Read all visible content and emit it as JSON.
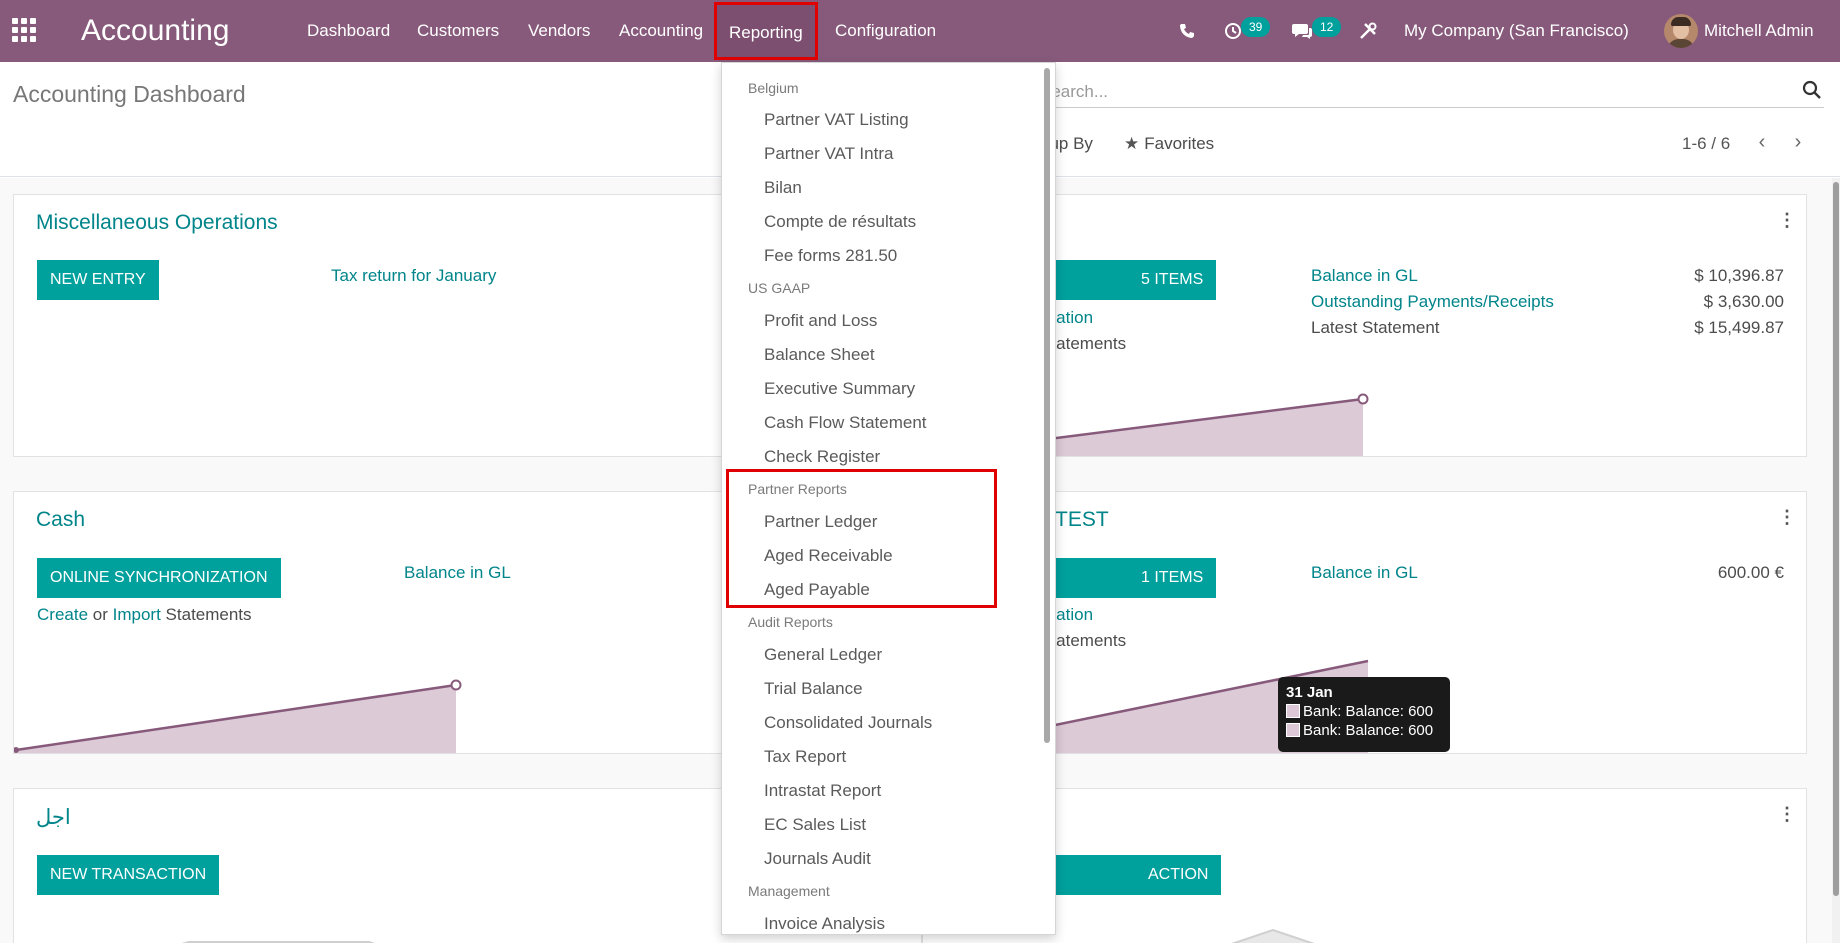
{
  "navbar": {
    "app_title": "Accounting",
    "menu": [
      "Dashboard",
      "Customers",
      "Vendors",
      "Accounting",
      "Reporting",
      "Configuration"
    ],
    "activity_count": "39",
    "message_count": "12",
    "company": "My Company (San Francisco)",
    "user": "Mitchell Admin"
  },
  "control": {
    "title": "Accounting Dashboard",
    "search_placeholder": "Search...",
    "group_by": "oup By",
    "favorites": "Favorites",
    "pager": "1-6 / 6"
  },
  "reporting_menu": {
    "sections": [
      {
        "header": "Belgium",
        "items": [
          "Partner VAT Listing",
          "Partner VAT Intra",
          "Bilan",
          "Compte de résultats",
          "Fee forms 281.50"
        ]
      },
      {
        "header": "US GAAP",
        "items": [
          "Profit and Loss",
          "Balance Sheet",
          "Executive Summary",
          "Cash Flow Statement",
          "Check Register"
        ]
      },
      {
        "header": "Partner Reports",
        "items": [
          "Partner Ledger",
          "Aged Receivable",
          "Aged Payable"
        ]
      },
      {
        "header": "Audit Reports",
        "items": [
          "General Ledger",
          "Trial Balance",
          "Consolidated Journals",
          "Tax Report",
          "Intrastat Report",
          "EC Sales List",
          "Journals Audit"
        ]
      },
      {
        "header": "Management",
        "items": [
          "Invoice Analysis"
        ]
      }
    ]
  },
  "cards": {
    "misc": {
      "title": "Miscellaneous Operations",
      "button": "New Entry",
      "link": "Tax return for January"
    },
    "bank": {
      "button_partial": "5 Items",
      "sync_partial": "onization",
      "import_partial": "rt Statements",
      "balance_label": "Balance in GL",
      "balance_value": "$ 10,396.87",
      "outstanding_label": "Outstanding Payments/Receipts",
      "outstanding_value": "$ 3,630.00",
      "latest_label": "Latest Statement",
      "latest_value": "$ 15,499.87"
    },
    "cash": {
      "title": "Cash",
      "button": "Online Synchronization",
      "balance_label": "Balance in GL",
      "create": "Create",
      "or": "or",
      "import": "Import",
      "statements": "Statements"
    },
    "test": {
      "title_partial": "TEST",
      "button_partial": "1 Items",
      "sync_partial": "onization",
      "import_partial": "rt Statements",
      "balance_label": "Balance in GL",
      "balance_value": "600.00 €"
    },
    "ajal": {
      "title": "اجل",
      "button": "New Transaction"
    },
    "last": {
      "button_partial": "ACTION"
    }
  },
  "tooltip": {
    "date": "31 Jan",
    "rows": [
      "Bank: Balance: 600",
      "Bank: Balance: 600"
    ]
  },
  "colors": {
    "brand": "#875a7b",
    "accent": "#00a09d",
    "link": "#00858a",
    "highlight": "#e00000"
  }
}
